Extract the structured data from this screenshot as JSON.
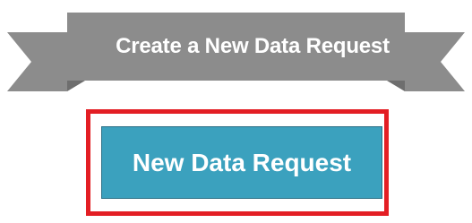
{
  "banner": {
    "title": "Create a New Data Request",
    "color": "#8c8c8c",
    "fold_color": "#6e6e6e"
  },
  "highlight": {
    "color": "#e31e24"
  },
  "request_button": {
    "label": "New Data Request",
    "background": "#3ba1be"
  }
}
